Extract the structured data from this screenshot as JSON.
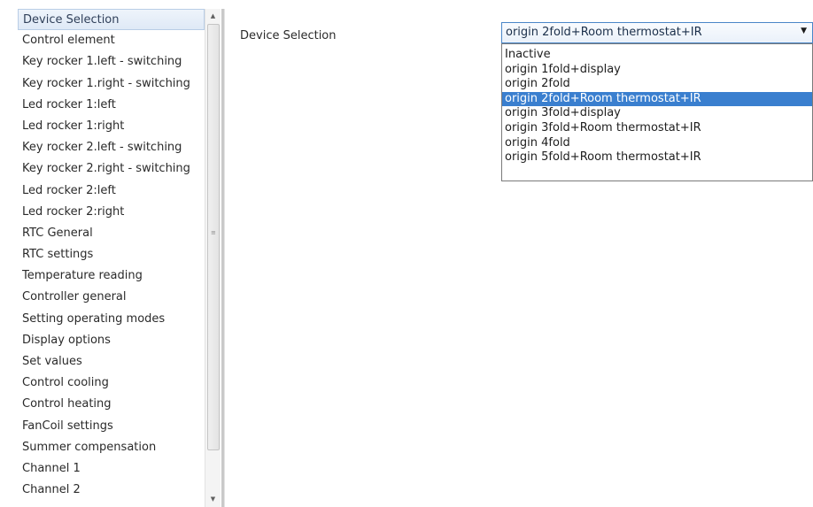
{
  "sidebar": {
    "items": [
      {
        "label": "Device Selection",
        "selected": true
      },
      {
        "label": "Control element"
      },
      {
        "label": "Key rocker 1.left - switching"
      },
      {
        "label": "Key rocker 1.right - switching"
      },
      {
        "label": "Led rocker 1:left"
      },
      {
        "label": "Led rocker 1:right"
      },
      {
        "label": "Key rocker 2.left - switching"
      },
      {
        "label": "Key rocker 2.right - switching"
      },
      {
        "label": "Led rocker 2:left"
      },
      {
        "label": "Led rocker 2:right"
      },
      {
        "label": "RTC General"
      },
      {
        "label": "RTC settings"
      },
      {
        "label": "Temperature reading"
      },
      {
        "label": "Controller general"
      },
      {
        "label": "Setting operating modes"
      },
      {
        "label": "Display options"
      },
      {
        "label": "Set values"
      },
      {
        "label": "Control cooling"
      },
      {
        "label": "Control heating"
      },
      {
        "label": "FanCoil settings"
      },
      {
        "label": "Summer compensation"
      },
      {
        "label": "Channel 1"
      },
      {
        "label": "Channel 2"
      }
    ],
    "scroll_up_icon": "▲",
    "scroll_down_icon": "▼",
    "thumb_grip_icon": "≡"
  },
  "main": {
    "parameter_label": "Device Selection",
    "combo": {
      "selected_value": "origin 2fold+Room thermostat+IR",
      "arrow_icon": "▼"
    },
    "dropdown_options": [
      {
        "label": "Inactive"
      },
      {
        "label": "origin 1fold+display"
      },
      {
        "label": "origin 2fold"
      },
      {
        "label": "origin 2fold+Room thermostat+IR",
        "highlighted": true
      },
      {
        "label": "origin 3fold+display"
      },
      {
        "label": "origin 3fold+Room thermostat+IR"
      },
      {
        "label": "origin 4fold"
      },
      {
        "label": "origin 5fold+Room thermostat+IR"
      }
    ]
  },
  "colors": {
    "selection_highlight": "#3a7fcf",
    "combo_border": "#4a86c8",
    "sidebar_selected_bg": "#dfe9f6"
  }
}
